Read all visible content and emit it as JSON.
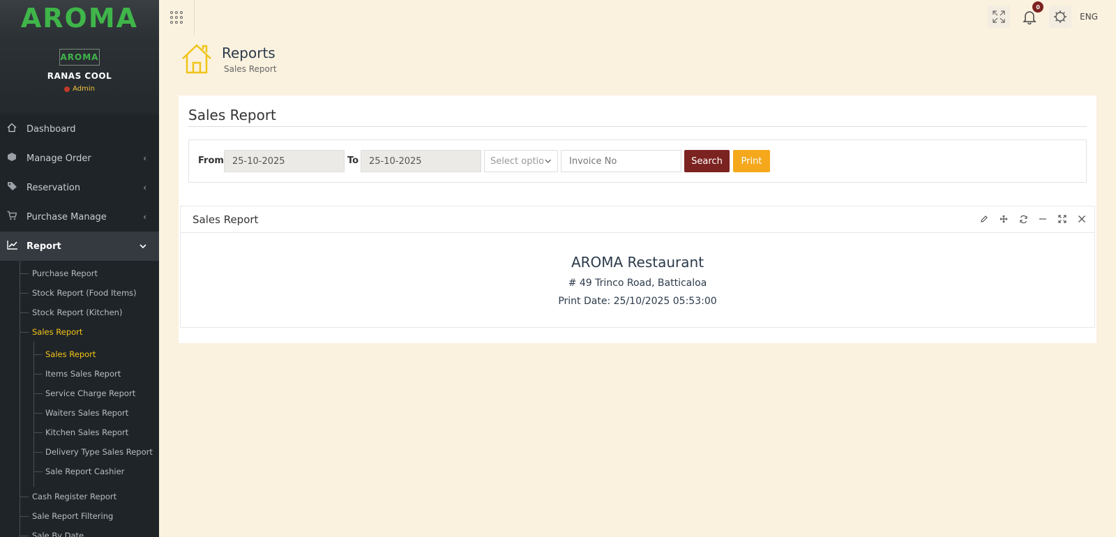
{
  "brand": {
    "logo_text": "AROMA"
  },
  "profile": {
    "logo_text": "AROMA",
    "name": "RANAS COOL",
    "role": "Admin"
  },
  "nav": [
    {
      "label": "Dashboard",
      "icon": "home-icon",
      "has_submenu": false
    },
    {
      "label": "Manage Order",
      "icon": "cube-icon",
      "has_submenu": true
    },
    {
      "label": "Reservation",
      "icon": "tags-icon",
      "has_submenu": true
    },
    {
      "label": "Purchase Manage",
      "icon": "cart-icon",
      "has_submenu": true
    },
    {
      "label": "Report",
      "icon": "chart-line-icon",
      "has_submenu": true,
      "expanded": true
    }
  ],
  "report_sub": {
    "before": [
      "Purchase Report",
      "Stock Report (Food Items)",
      "Stock Report (Kitchen)"
    ],
    "sales_report": "Sales Report",
    "sales_children": [
      "Sales Report",
      "Items Sales Report",
      "Service Charge Report",
      "Waiters Sales Report",
      "Kitchen Sales Report",
      "Delivery Type Sales Report",
      "Sale Report Cashier"
    ],
    "after": [
      "Cash Register Report",
      "Sale Report Filtering",
      "Sale By Date"
    ]
  },
  "topbar": {
    "notification_count": "0",
    "language": "ENG"
  },
  "page_header": {
    "title": "Reports",
    "subtitle": "Sales Report"
  },
  "card": {
    "title": "Sales Report"
  },
  "filter": {
    "from_label": "From",
    "from_value": "25-10-2025",
    "to_label": "To",
    "to_value": "25-10-2025",
    "select_placeholder": "Select option",
    "invoice_placeholder": "Invoice No",
    "search_label": "Search",
    "print_label": "Print"
  },
  "panel": {
    "title": "Sales Report",
    "restaurant_name": "AROMA Restaurant",
    "address": "# 49 Trinco Road, Batticaloa",
    "print_date": "Print Date: 25/10/2025 05:53:00"
  },
  "colors": {
    "accent": "#f5c518",
    "brand_green": "#3fb54a",
    "search_btn": "#7b2320",
    "print_btn": "#f5a81c",
    "sidebar_bg": "#1f2428",
    "page_bg": "#faf1df"
  }
}
